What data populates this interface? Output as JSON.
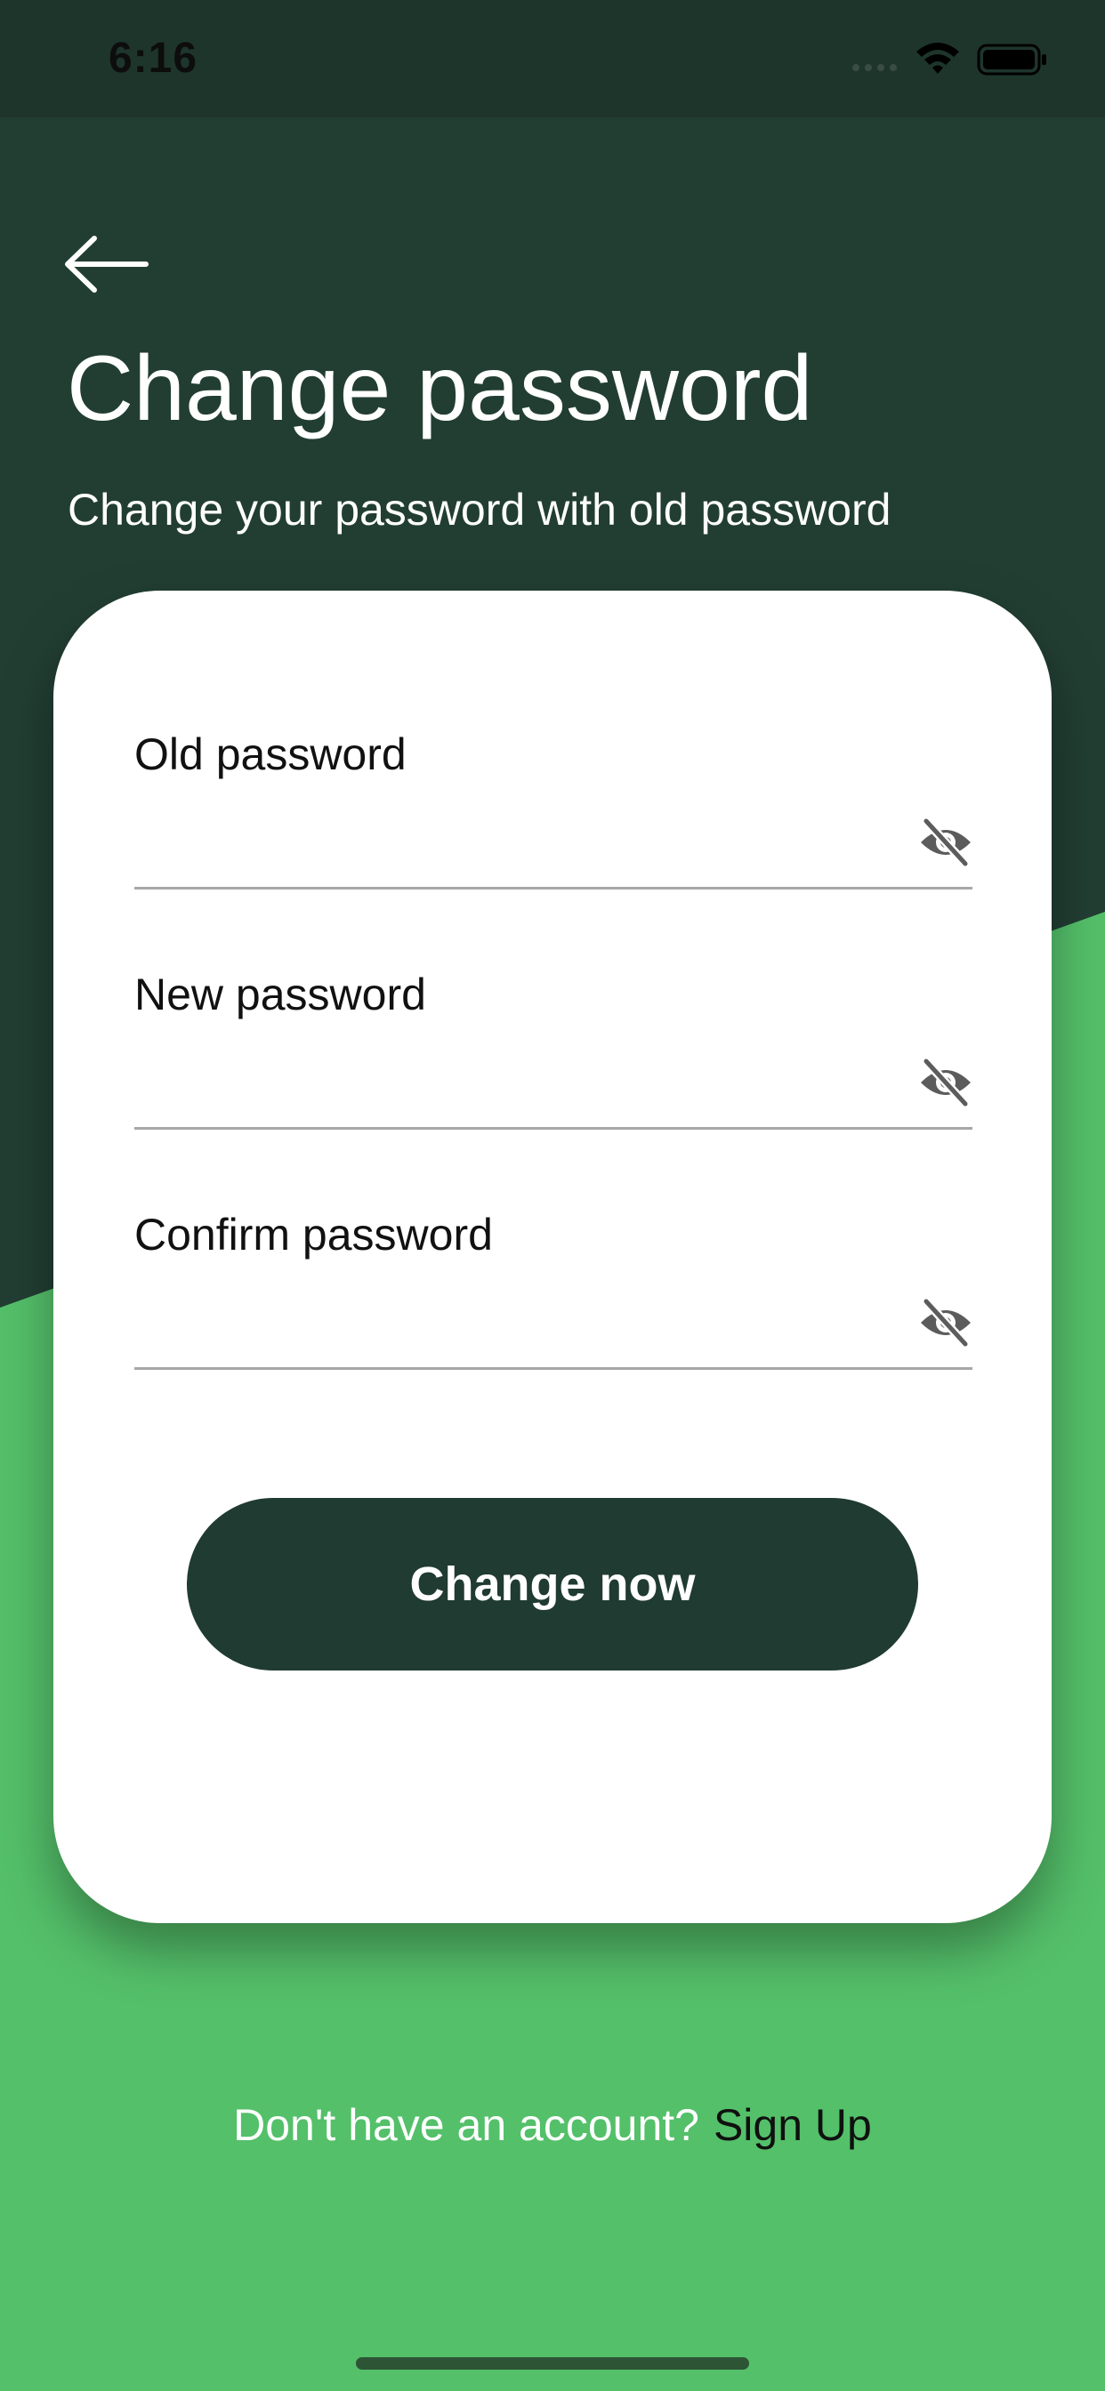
{
  "status_bar": {
    "time": "6:16",
    "icons": [
      "cellular-signal-icon",
      "wifi-icon",
      "battery-icon"
    ]
  },
  "header": {
    "back_icon": "arrow-left-icon",
    "title": "Change password",
    "subtitle": "Change your password with old password"
  },
  "form": {
    "fields": [
      {
        "label": "Old password",
        "value": "",
        "icon": "eye-slash-icon"
      },
      {
        "label": "New password",
        "value": "",
        "icon": "eye-slash-icon"
      },
      {
        "label": "Confirm password",
        "value": "",
        "icon": "eye-slash-icon"
      }
    ],
    "submit_label": "Change now"
  },
  "footer": {
    "text": "Don't have an account?",
    "link": "Sign Up"
  },
  "colors": {
    "dark_green": "#223e33",
    "accent_green": "#54c06a",
    "card": "#ffffff",
    "button": "#203b31"
  }
}
